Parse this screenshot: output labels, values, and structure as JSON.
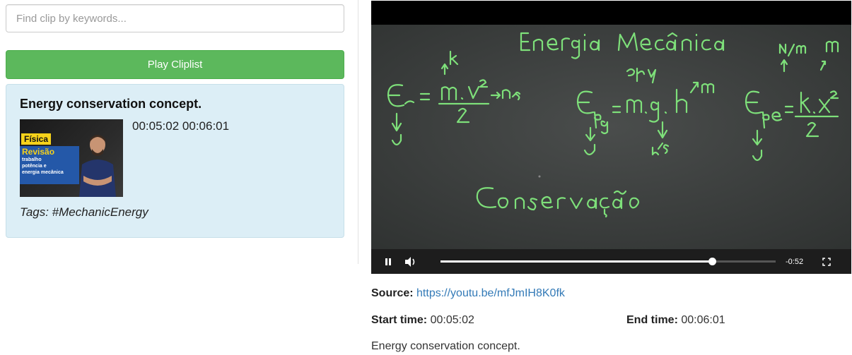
{
  "search": {
    "placeholder": "Find clip by keywords..."
  },
  "play_button": {
    "label": "Play Cliplist"
  },
  "clip": {
    "title": "Energy conservation concept.",
    "start": "00:05:02",
    "end": "00:06:01",
    "tags": "Tags: #MechanicEnergy",
    "thumbnail": {
      "badge": "Física",
      "heading": "Revisão",
      "lines": [
        "trabalho",
        "potência e",
        "energia mecânica"
      ]
    }
  },
  "player": {
    "remaining": "-0:52",
    "progress": 0.81,
    "icons": [
      "pause-icon",
      "volume-icon",
      "fullscreen-icon"
    ]
  },
  "details": {
    "source_label": "Source:",
    "source_url": "https://youtu.be/mfJmIH8K0fk",
    "start_label": "Start time:",
    "start_value": "00:05:02",
    "end_label": "End time:",
    "end_value": "00:06:01",
    "description": "Energy conservation concept."
  },
  "colors": {
    "play_button": "#5cb85c",
    "card_bg": "#dceef6",
    "link": "#337ab7",
    "chalk": "#7ee07a"
  }
}
